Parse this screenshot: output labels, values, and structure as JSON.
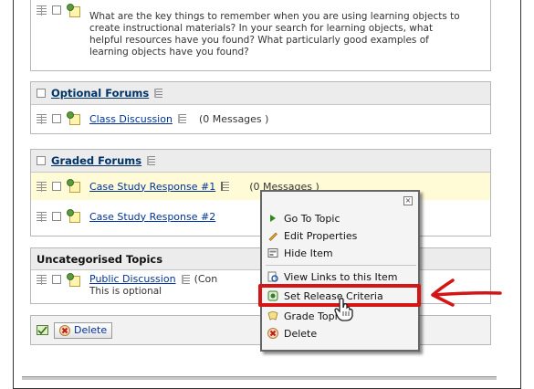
{
  "first_topic": {
    "description": "What are the key things to remember when you are using learning objects to create instructional materials? In your search for learning objects, what helpful resources have you found? What particularly good examples of learning objects have you found?"
  },
  "optional_forums": {
    "title": "Optional Forums",
    "topics": [
      {
        "name": "Class Discussion",
        "count": "(0 Messages )"
      }
    ]
  },
  "graded_forums": {
    "title": "Graded Forums",
    "topics": [
      {
        "name": "Case Study Response #1",
        "count": "(0 Messages )"
      },
      {
        "name": "Case Study Response #2"
      }
    ]
  },
  "uncategorised": {
    "title": "Uncategorised Topics",
    "topics": [
      {
        "name": "Public Discussion",
        "count": "(Con",
        "description": "This is optional"
      }
    ]
  },
  "context_menu": {
    "close": "×",
    "items": [
      {
        "label": "Go To Topic",
        "icon": "arrow-right-icon"
      },
      {
        "label": "Edit Properties",
        "icon": "pencil-icon"
      },
      {
        "label": "Hide Item",
        "icon": "hide-icon"
      },
      {
        "label": "View Links to this Item",
        "icon": "links-icon"
      },
      {
        "label": "Set Release Criteria",
        "icon": "release-criteria-icon"
      },
      {
        "label": "Grade Topic",
        "icon": "grade-icon"
      },
      {
        "label": "Delete",
        "icon": "delete-icon"
      }
    ]
  },
  "bottom_bar": {
    "delete_label": "Delete"
  },
  "colors": {
    "link": "#003399",
    "callout": "#d41515",
    "highlight_row": "#fffbd6"
  }
}
